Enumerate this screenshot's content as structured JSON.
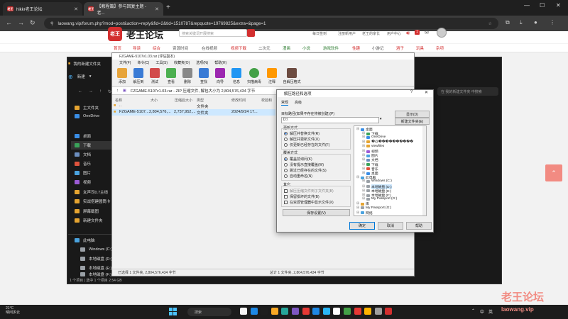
{
  "browser": {
    "tabs": [
      {
        "title": "hikkr老王论坛",
        "favicon": "老王"
      },
      {
        "title": "【教程篇】参与回复主题 - 老...",
        "favicon": "老王"
      }
    ],
    "url": "laowang.vip/forum.php?mod=post&action=reply&fid=2&tid=1510787&repquote=19769825&extra=&page=1"
  },
  "site": {
    "logo": "老王论坛",
    "logo_mark": "老王",
    "search_placeholder": "搜索关键词开展搜索",
    "header_links": [
      "每日签到",
      "注册新用户",
      "老王的家长",
      "用户中心"
    ],
    "badge_count": "1",
    "nav": [
      "首页",
      "导读",
      "综合",
      "资源时间",
      "在线视频",
      "视频下载",
      "二次元",
      "漫画",
      "小说",
      "游戏软件",
      "性趣",
      "小游记",
      "酒子",
      "玩具",
      "杂项"
    ],
    "watermark_cn": "老王论坛",
    "watermark_en": "laowang.vip"
  },
  "explorer": {
    "title": "我的新建文件夹",
    "new_button": "新建",
    "search_placeholder": "在 我的新建文件夹 中搜索",
    "sidebar": [
      {
        "label": "主文件夹",
        "color": "#e5a431"
      },
      {
        "label": "OneDrive",
        "color": "#3a8ee6"
      },
      {
        "label": "桌面",
        "color": "#3a8ee6"
      },
      {
        "label": "下载",
        "color": "#3aa35a"
      },
      {
        "label": "文档",
        "color": "#6c8ebf"
      },
      {
        "label": "音乐",
        "color": "#e0533d"
      },
      {
        "label": "图片",
        "color": "#4aa3df"
      },
      {
        "label": "视频",
        "color": "#9c5bd6"
      },
      {
        "label": "女声司0.7主线",
        "color": "#e5a431"
      },
      {
        "label": "实战搭建圆筒卡",
        "color": "#e5a431"
      },
      {
        "label": "屏幕截图",
        "color": "#e5a431"
      },
      {
        "label": "新建文件夹",
        "color": "#e5a431"
      }
    ],
    "tree": [
      {
        "label": "此电脑",
        "color": "#4aa3df"
      },
      {
        "label": "Windows (C:)",
        "color": "#9aa0a6"
      },
      {
        "label": "本地磁盘 (D:)",
        "color": "#9aa0a6"
      },
      {
        "label": "本地磁盘 (E:)",
        "color": "#9aa0a6"
      },
      {
        "label": "本地磁盘 (F:)",
        "color": "#9aa0a6"
      }
    ],
    "status": "1 个项目  |  选中 1 个项目  2.54 GB"
  },
  "winrar": {
    "title": "FZGAME-5107v1.03.rar (评估副本)",
    "menu": [
      "文件(F)",
      "命令(C)",
      "工具(S)",
      "收藏夹(O)",
      "选项(N)",
      "帮助(H)"
    ],
    "toolbar": [
      {
        "label": "添加",
        "color": "#e7a43a"
      },
      {
        "label": "解压到",
        "color": "#3a7bd5"
      },
      {
        "label": "测试",
        "color": "#d24b4b"
      },
      {
        "label": "查看",
        "color": "#4caf50"
      },
      {
        "label": "删除",
        "color": "#888888"
      },
      {
        "label": "查找",
        "color": "#3a7bd5"
      },
      {
        "label": "向导",
        "color": "#9c27b0"
      },
      {
        "label": "信息",
        "color": "#2196f3"
      },
      {
        "label": "扫描病毒",
        "color": "#43a047"
      },
      {
        "label": "注释",
        "color": "#ff9800"
      },
      {
        "label": "自解压格式",
        "color": "#6d4c41"
      }
    ],
    "path": "FZGAME-5107v1.03.rar - ZIP 压缩文件, 解包大小为 2,804,576,434 字节",
    "columns": [
      "名称",
      "大小",
      "压缩后大小",
      "类型",
      "修改时间",
      "校验和"
    ],
    "rows": [
      {
        "name": "..",
        "size": "",
        "packed": "",
        "type": "文件夹",
        "mtime": "",
        "crc": ""
      },
      {
        "name": "FZGAME-5107...",
        "size": "2,804,576,...",
        "packed": "2,737,952,...",
        "type": "文件夹",
        "mtime": "2024/9/24 17...",
        "crc": ""
      }
    ],
    "status_left": "已选择 1 文件夹, 2,804,576,434 字节",
    "status_right": "总计 1 文件夹, 2,804,576,434 字节"
  },
  "dialog": {
    "title": "解压路径和选项",
    "tabs": [
      "常规",
      "高级"
    ],
    "target_label": "目标路径(如果不存在将被创建)(P)",
    "target_value": "D:\\",
    "show_button": "显示(D)",
    "newfolder_button": "新建文件夹(E)",
    "update_group": "更新方式",
    "update_options": [
      "解压并替换文件(R)",
      "解压并更新文件(U)",
      "仅更新已经存在的文件(F)"
    ],
    "overwrite_group": "覆盖方式",
    "overwrite_options": [
      "覆盖前询问(K)",
      "没有提示直接覆盖(W)",
      "跳过已经存在的文件(S)",
      "自动重命名(N)"
    ],
    "misc_group": "其它",
    "misc_options": [
      "解压压缩文件到子文件夹(B)",
      "保留损坏的文件(B)",
      "在资源管理器中显示文件(X)"
    ],
    "save_button": "保存设置(V)",
    "tree": [
      {
        "label": "桌面",
        "color": "#3a8ee6",
        "selected": false
      },
      {
        "label": "下载",
        "color": "#3aa35a",
        "selected": false
      },
      {
        "label": "OneDrive",
        "color": "#3a8ee6",
        "selected": false
      },
      {
        "label": "�@����������",
        "color": "#e5a431",
        "selected": false
      },
      {
        "label": "viewfiles",
        "color": "#e5a431",
        "selected": false
      },
      {
        "label": "视频",
        "color": "#9c5bd6",
        "selected": false
      },
      {
        "label": "图片",
        "color": "#4aa3df",
        "selected": false
      },
      {
        "label": "文档",
        "color": "#6c8ebf",
        "selected": false
      },
      {
        "label": "下载",
        "color": "#3aa35a",
        "selected": false
      },
      {
        "label": "音乐",
        "color": "#e0533d",
        "selected": false
      },
      {
        "label": "桌面",
        "color": "#3a8ee6",
        "selected": false
      },
      {
        "label": "此电脑",
        "color": "#4aa3df",
        "selected": false
      },
      {
        "label": "Windows (C:)",
        "color": "#9aa0a6",
        "selected": false
      },
      {
        "label": "本地磁盘 (D:)",
        "color": "#9aa0a6",
        "selected": true
      },
      {
        "label": "本地磁盘 (E:)",
        "color": "#9aa0a6",
        "selected": false
      },
      {
        "label": "本地磁盘 (F:)",
        "color": "#9aa0a6",
        "selected": false
      },
      {
        "label": "My Passport (G:)",
        "color": "#9aa0a6",
        "selected": false
      },
      {
        "label": "库",
        "color": "#e5a431",
        "selected": false
      },
      {
        "label": "My Passport (G:)",
        "color": "#9aa0a6",
        "selected": false
      },
      {
        "label": "网络",
        "color": "#4aa3df",
        "selected": false
      }
    ],
    "ok": "确定",
    "cancel": "取消",
    "help": "帮助"
  },
  "taskbar": {
    "temp": "21°C",
    "weather": "晴间多云",
    "search": "搜索",
    "apps": [
      "#f5f5f5",
      "#1e88e5",
      "#1e1e1e",
      "#f9a825",
      "#26a69a",
      "#7e57c2",
      "#e53935",
      "#1e88e5",
      "#29b6f6",
      "#ffffff",
      "#43a047",
      "#e53935",
      "#ffb300",
      "#9e9e9e",
      "#d32f2f"
    ],
    "tray": [
      "中",
      "英"
    ]
  }
}
